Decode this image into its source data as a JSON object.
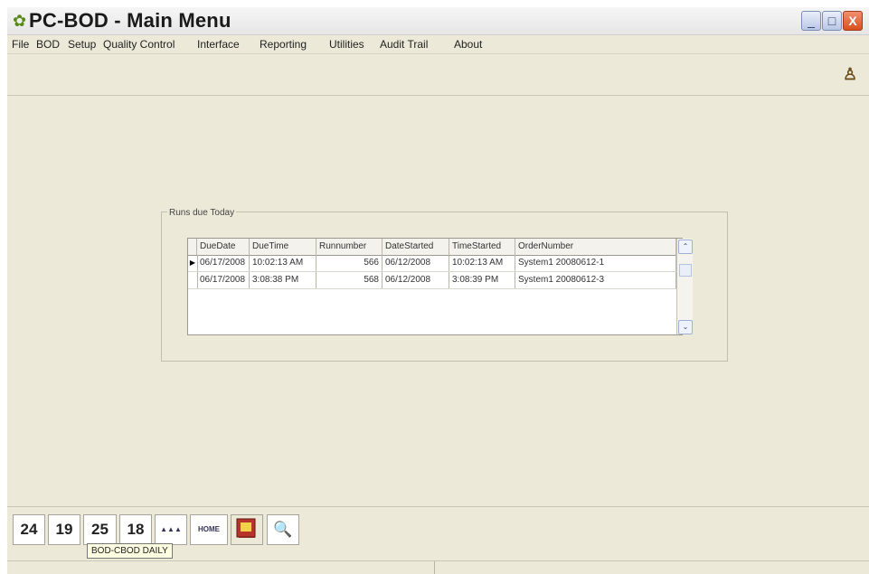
{
  "window": {
    "title": "PC-BOD - Main Menu",
    "buttons": {
      "minimize": "_",
      "maximize": "□",
      "close": "X"
    }
  },
  "menubar": {
    "items": [
      "File",
      "BOD",
      "Setup",
      "Quality Control",
      "Interface",
      "Reporting",
      "Utilities",
      "Audit Trail",
      "About"
    ]
  },
  "group": {
    "label": "Runs due Today"
  },
  "grid": {
    "columns": [
      "DueDate",
      "DueTime",
      "Runnumber",
      "DateStarted",
      "TimeStarted",
      "OrderNumber"
    ],
    "rows": [
      [
        "06/17/2008",
        "10:02:13 AM",
        "566",
        "06/12/2008",
        "10:02:13 AM",
        "System1 20080612-1"
      ],
      [
        "06/17/2008",
        "3:08:38 PM",
        "568",
        "06/12/2008",
        "3:08:39 PM",
        "System1 20080612-3"
      ]
    ],
    "current_row_indicator": "▶",
    "scroll": {
      "up": "⌃",
      "down": "⌄"
    }
  },
  "bottom_tiles": [
    {
      "label": "24"
    },
    {
      "label": "19"
    },
    {
      "label": "25"
    },
    {
      "label": "18"
    },
    {
      "label": "▲▲▲"
    },
    {
      "label": "HOME"
    },
    {
      "label": ""
    },
    {
      "label": "🔍"
    }
  ],
  "tooltip": {
    "text": "BOD-CBOD DAILY"
  },
  "icons": {
    "app_icon": "leaf-icon",
    "toolbar_person": "person-icon",
    "book": "book-icon",
    "search": "search-icon"
  }
}
